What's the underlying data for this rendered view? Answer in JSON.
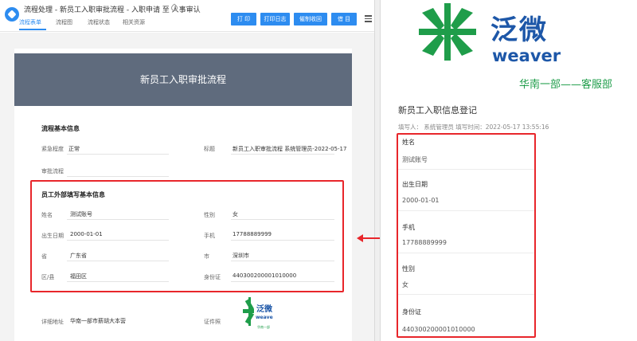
{
  "window": {
    "title": "流程处理 - 新员工入职审批流程 - 入职申请 至 人事审认",
    "tabs": [
      "流程表单",
      "流程图",
      "流程状态",
      "相关资源"
    ],
    "buttons": [
      "打 印",
      "打印日志",
      "催制收回",
      "借 目"
    ]
  },
  "form": {
    "banner_title": "新员工入职审批流程",
    "basic_section": {
      "heading": "流程基本信息",
      "fields": [
        {
          "label": "紧急程度",
          "value": "正常"
        },
        {
          "label": "标题",
          "value": "新员工入职审批流程 系统管理员-2022-05-17"
        },
        {
          "label": "审批流程",
          "value": ""
        }
      ]
    },
    "employee_section": {
      "heading": "员工外部填写基本信息",
      "fields": [
        {
          "label": "姓名",
          "value": "测试账号"
        },
        {
          "label": "性别",
          "value": "女"
        },
        {
          "label": "出生日期",
          "value": "2000-01-01"
        },
        {
          "label": "手机",
          "value": "17788889999"
        },
        {
          "label": "省",
          "value": "广东省"
        },
        {
          "label": "市",
          "value": "深圳市"
        },
        {
          "label": "区/县",
          "value": "福田区"
        },
        {
          "label": "身份证",
          "value": "440300200001010000"
        }
      ]
    },
    "address": {
      "label": "详细地址",
      "value": "华南一部市薪胡大本营"
    },
    "photo_label": "证件照",
    "mini_logo_text": "泛微",
    "mini_logo_en": "weaver",
    "mini_logo_dept": "华南一部"
  },
  "panel": {
    "brand_cn": "泛微",
    "brand_en": "weaver",
    "dept": "华南一部——客服部",
    "form_title": "新员工入职信息登记",
    "meta": "填写人：  系统管理员     填写时间：2022-05-17 13:55:16",
    "fields": [
      {
        "label": "姓名",
        "value": "测试账号"
      },
      {
        "label": "出生日期",
        "value": "2000-01-01"
      },
      {
        "label": "手机",
        "value": "17788889999"
      },
      {
        "label": "性别",
        "value": "女"
      },
      {
        "label": "身份证",
        "value": "440300200001010000"
      }
    ]
  },
  "colors": {
    "primary": "#2d8cf0",
    "banner": "#5f6b7d",
    "highlight": "#e8262b",
    "brand_blue": "#1d57a8",
    "brand_green": "#1f9d4a"
  }
}
